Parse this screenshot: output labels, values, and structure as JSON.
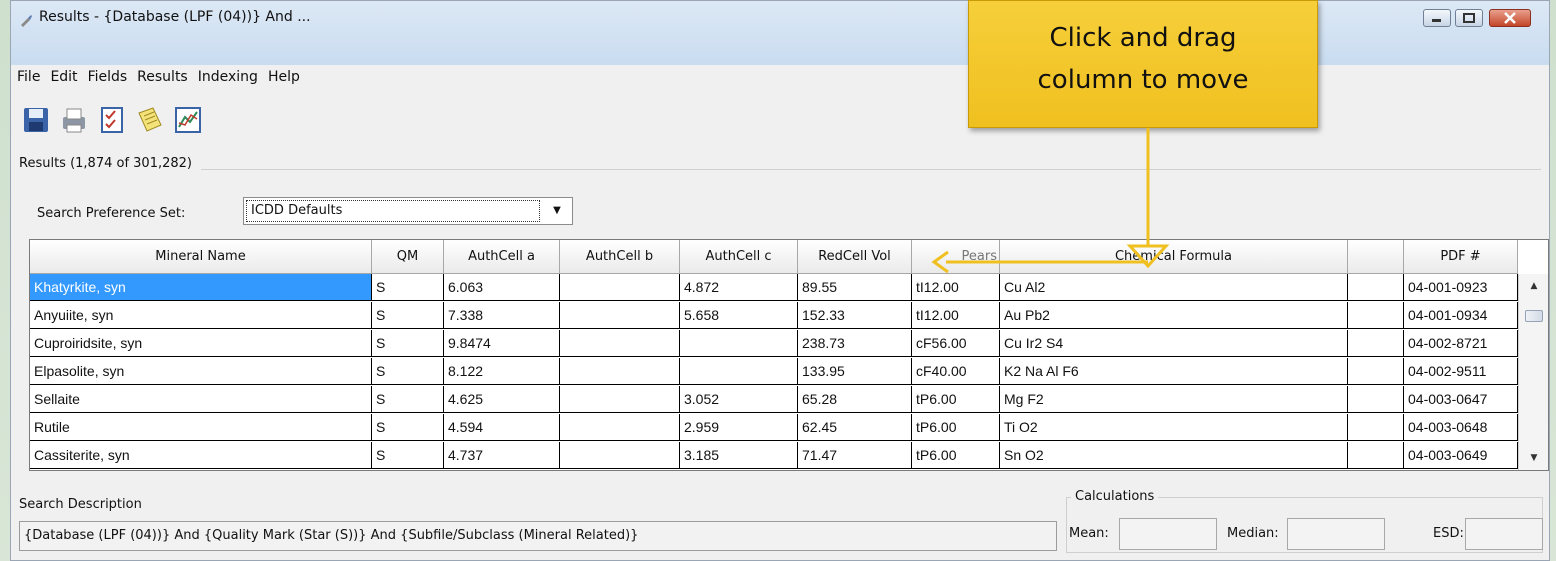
{
  "window": {
    "title": "Results - {Database (LPF (04))} And ..."
  },
  "menu": [
    "File",
    "Edit",
    "Fields",
    "Results",
    "Indexing",
    "Help"
  ],
  "toolbar_icons": [
    "save-icon",
    "print-icon",
    "checklist-icon",
    "notes-icon",
    "chart-icon"
  ],
  "results": {
    "label": "Results (1,874 of 301,282)"
  },
  "search_pref": {
    "label": "Search Preference Set:",
    "value": "ICDD Defaults"
  },
  "table": {
    "headers": [
      "Mineral Name",
      "QM",
      "AuthCell a",
      "AuthCell b",
      "AuthCell c",
      "RedCell Vol",
      "Pears",
      "Chemical Formula",
      "",
      "PDF #"
    ],
    "rows": [
      [
        "Khatyrkite, syn",
        "S",
        "6.063",
        "",
        "4.872",
        "89.55",
        "tI12.00",
        "Cu Al2",
        "",
        "04-001-0923"
      ],
      [
        "Anyuiite, syn",
        "S",
        "7.338",
        "",
        "5.658",
        "152.33",
        "tI12.00",
        "Au Pb2",
        "",
        "04-001-0934"
      ],
      [
        "Cuproiridsite, syn",
        "S",
        "9.8474",
        "",
        "",
        "238.73",
        "cF56.00",
        "Cu Ir2 S4",
        "",
        "04-002-8721"
      ],
      [
        "Elpasolite, syn",
        "S",
        "8.122",
        "",
        "",
        "133.95",
        "cF40.00",
        "K2 Na Al F6",
        "",
        "04-002-9511"
      ],
      [
        "Sellaite",
        "S",
        "4.625",
        "",
        "3.052",
        "65.28",
        "tP6.00",
        "Mg F2",
        "",
        "04-003-0647"
      ],
      [
        "Rutile",
        "S",
        "4.594",
        "",
        "2.959",
        "62.45",
        "tP6.00",
        "Ti O2",
        "",
        "04-003-0648"
      ],
      [
        "Cassiterite, syn",
        "S",
        "4.737",
        "",
        "3.185",
        "71.47",
        "tP6.00",
        "Sn O2",
        "",
        "04-003-0649"
      ]
    ]
  },
  "search_description": {
    "label": "Search Description",
    "text": "{Database (LPF (04))} And {Quality Mark (Star (S))} And {Subfile/Subclass (Mineral Related)}"
  },
  "calculations": {
    "label": "Calculations",
    "mean_label": "Mean:",
    "median_label": "Median:",
    "esd_label": "ESD:"
  },
  "callout": {
    "line1": "Click and drag",
    "line2": "column to move"
  },
  "colors": {
    "selection": "#3399ff",
    "callout": "#f2c525",
    "arrow": "#f0c020"
  }
}
